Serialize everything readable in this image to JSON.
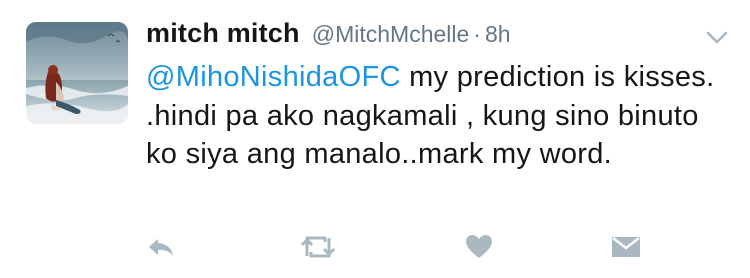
{
  "tweet": {
    "display_name": "mitch mitch",
    "handle": "@MitchMchelle",
    "separator": "·",
    "time": "8h",
    "mention": "@MihoNishidaOFC",
    "text": " my prediction is kisses. .hindi pa ako nagkamali , kung sino binuto ko siya ang manalo..mark my word."
  },
  "icons": {
    "reply": "reply-icon",
    "retweet": "retweet-icon",
    "like": "heart-icon",
    "dm": "envelope-icon",
    "caret": "chevron-down-icon"
  },
  "colors": {
    "mention": "#1b95e0",
    "secondary": "#657786",
    "icon": "#aab8c2",
    "text": "#14171a"
  }
}
